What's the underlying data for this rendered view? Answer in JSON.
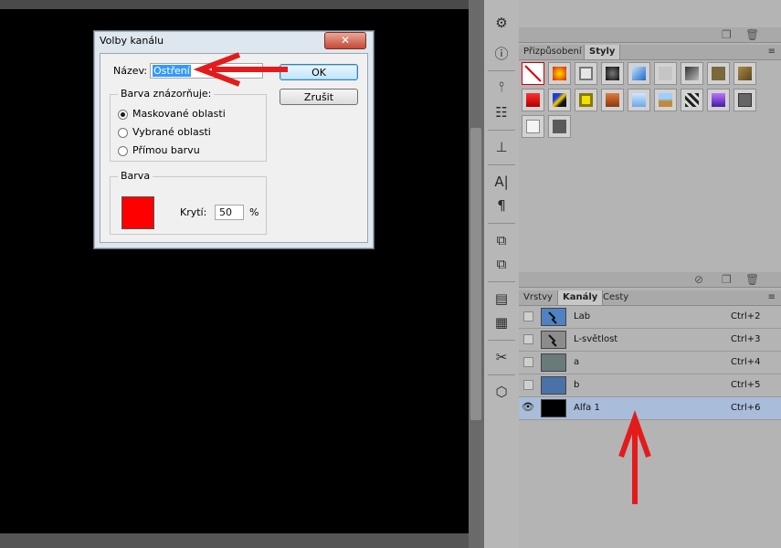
{
  "dialog": {
    "title": "Volby kanálu",
    "close_icon": "close-icon",
    "name_label": "Název:",
    "name_value": "Ostření",
    "ok_label": "OK",
    "cancel_label": "Zrušit",
    "indicates_group_title": "Barva znázorňuje:",
    "radio_options": [
      {
        "label": "Maskované oblasti",
        "selected": true
      },
      {
        "label": "Vybrané oblasti",
        "selected": false
      },
      {
        "label": "Přímou barvu",
        "selected": false
      }
    ],
    "color_group_title": "Barva",
    "swatch_color": "#ff0000",
    "opacity_label": "Krytí:",
    "opacity_value": "50",
    "opacity_unit": "%"
  },
  "styles_panel": {
    "tabs": [
      {
        "label": "Přizpůsobení",
        "active": false
      },
      {
        "label": "Styly",
        "active": true
      }
    ]
  },
  "channels_panel": {
    "tabs": [
      {
        "label": "Vrstvy",
        "active": false
      },
      {
        "label": "Kanály",
        "active": true
      },
      {
        "label": "Cesty",
        "active": false
      }
    ],
    "channels": [
      {
        "name": "Lab",
        "shortcut": "Ctrl+2",
        "visible": false,
        "selected": false
      },
      {
        "name": "L-světlost",
        "shortcut": "Ctrl+3",
        "visible": false,
        "selected": false
      },
      {
        "name": "a",
        "shortcut": "Ctrl+4",
        "visible": false,
        "selected": false
      },
      {
        "name": "b",
        "shortcut": "Ctrl+5",
        "visible": false,
        "selected": false
      },
      {
        "name": "Alfa 1",
        "shortcut": "Ctrl+6",
        "visible": true,
        "selected": true
      }
    ]
  },
  "annotations": {
    "arrow_color": "#e41b1b"
  },
  "colors": {
    "selected_row": "#a9bcd9",
    "dialog_frame": "#dfe7ee"
  }
}
